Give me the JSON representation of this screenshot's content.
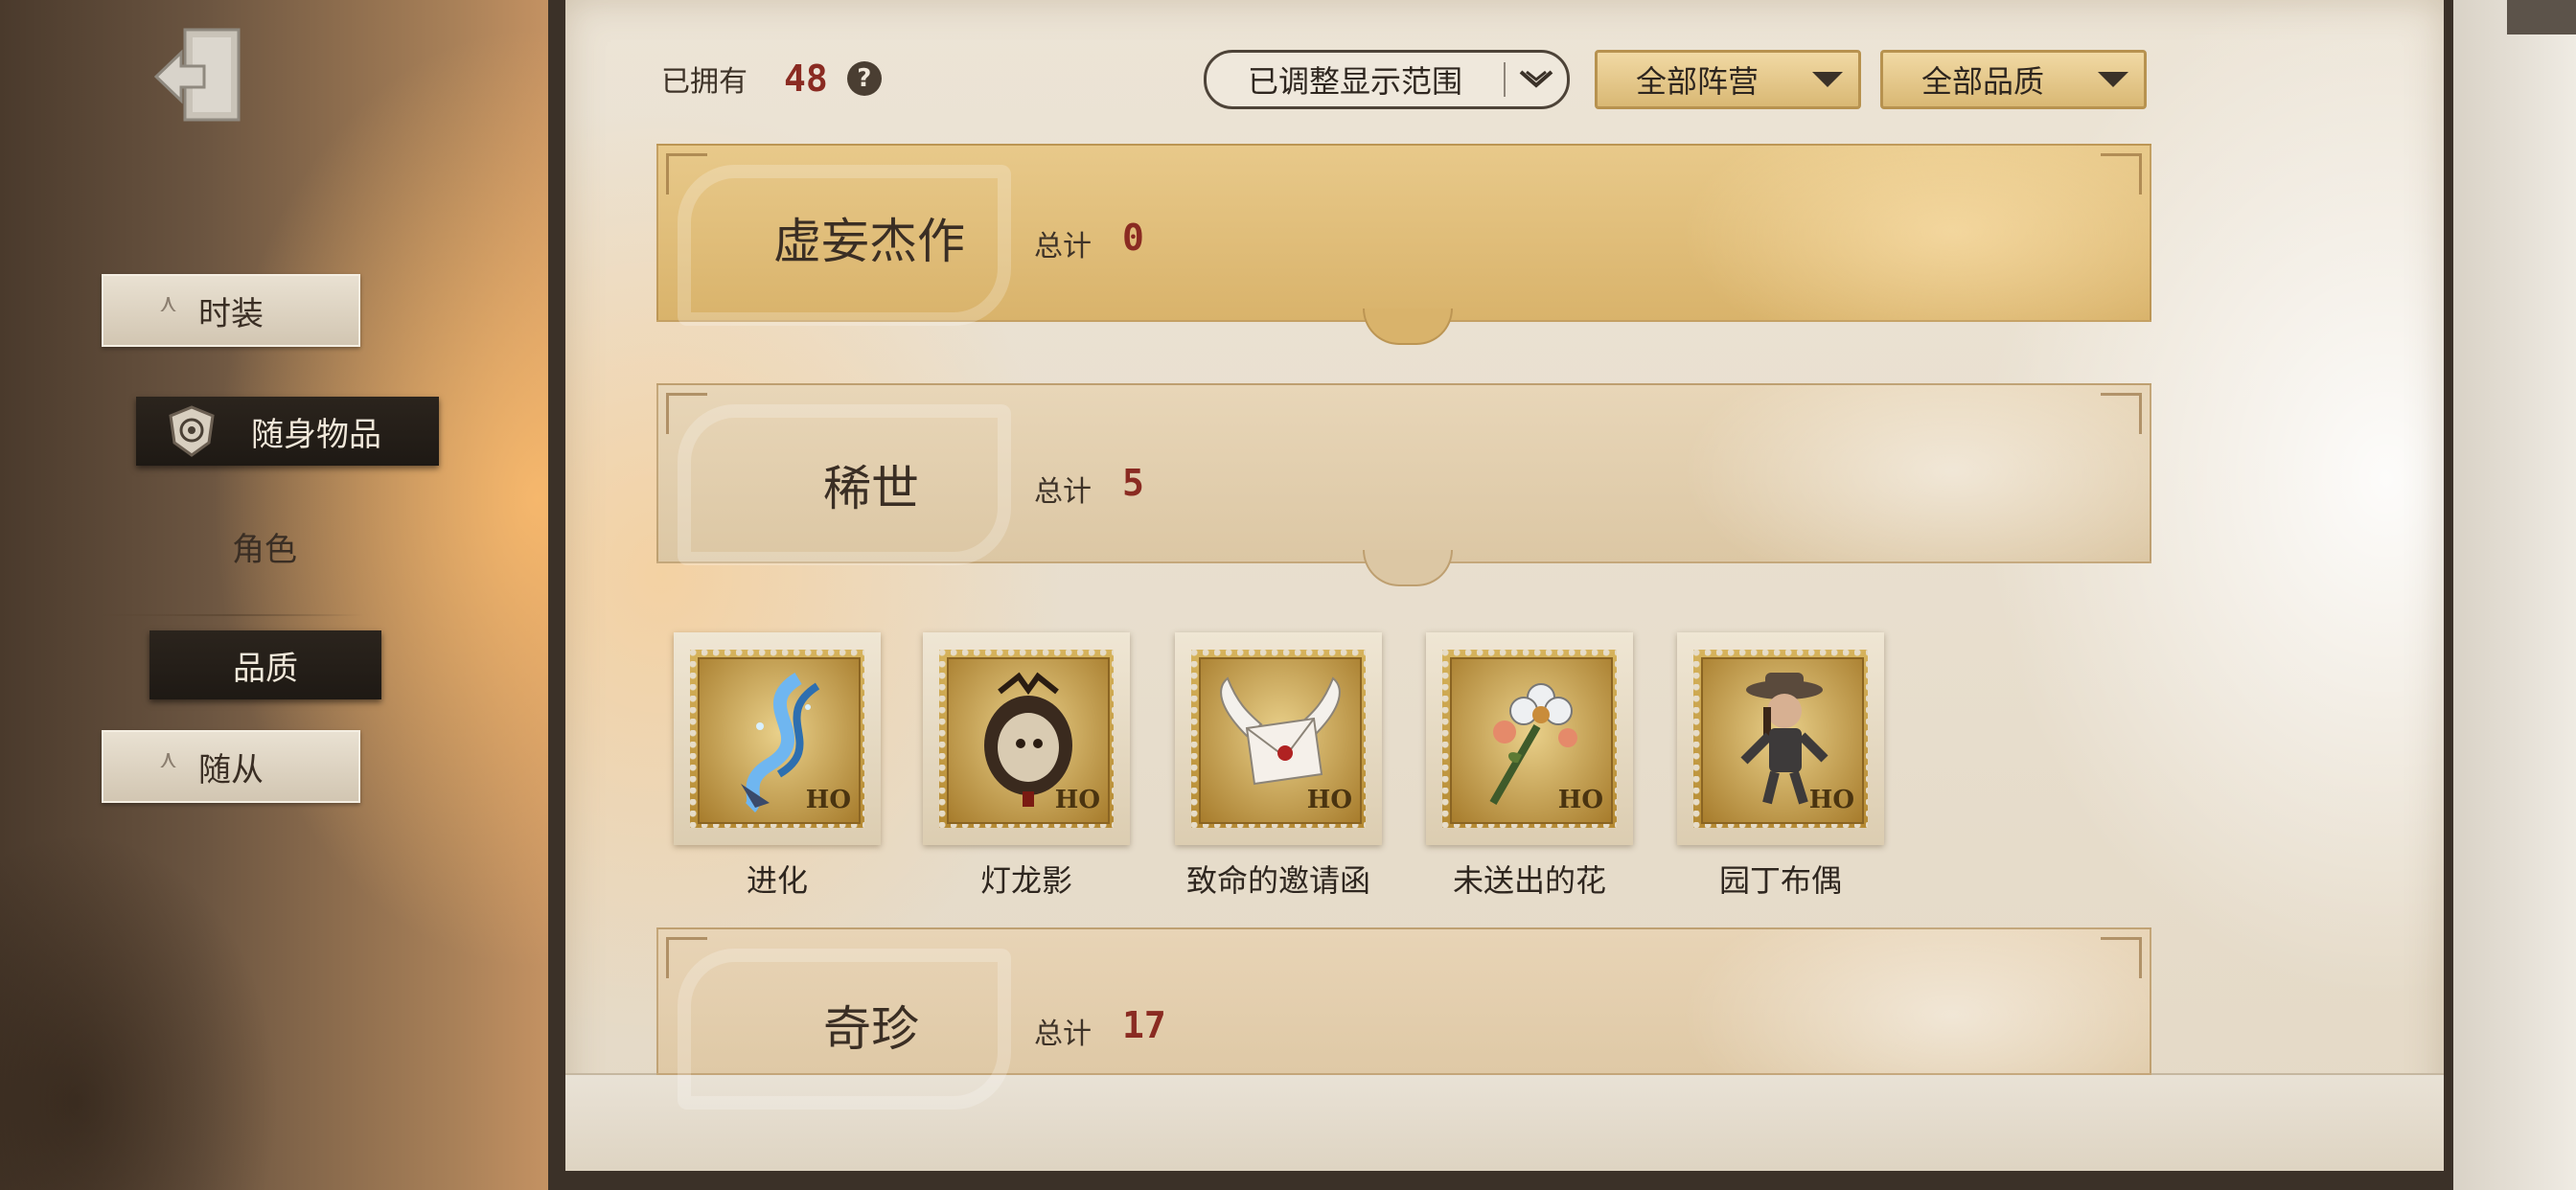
{
  "sidebar": {
    "back_icon": "exit-door-icon",
    "items": [
      {
        "label": "时装",
        "style": "paper"
      },
      {
        "label": "随身物品",
        "style": "dark-selected",
        "icon": "emblem-badge-icon"
      },
      {
        "label": "角色",
        "style": "plain"
      },
      {
        "label": "品质",
        "style": "dark-selected"
      },
      {
        "label": "随从",
        "style": "paper"
      }
    ]
  },
  "header": {
    "owned_label": "已拥有",
    "owned_count": "48",
    "help_symbol": "?",
    "filters": [
      {
        "label": "已调整显示范围"
      },
      {
        "label": "全部阵营"
      },
      {
        "label": "全部品质"
      }
    ]
  },
  "sections": [
    {
      "title": "虚妄杰作",
      "total_label": "总计",
      "total": "0"
    },
    {
      "title": "稀世",
      "total_label": "总计",
      "total": "5"
    },
    {
      "title": "奇珍",
      "total_label": "总计",
      "total": "17"
    }
  ],
  "items": [
    {
      "name": "进化",
      "stamp_value": "HO",
      "icon": "dna-helix-icon"
    },
    {
      "name": "灯龙影",
      "stamp_value": "HO",
      "icon": "lantern-icon"
    },
    {
      "name": "致命的邀请函",
      "stamp_value": "HO",
      "icon": "winged-envelope-icon"
    },
    {
      "name": "未送出的花",
      "stamp_value": "HO",
      "icon": "flower-bouquet-icon"
    },
    {
      "name": "园丁布偶",
      "stamp_value": "HO",
      "icon": "doll-icon"
    }
  ],
  "colors": {
    "accent_red": "#8a2b22",
    "gold": "#d9b36b",
    "dark": "#2b241d"
  }
}
